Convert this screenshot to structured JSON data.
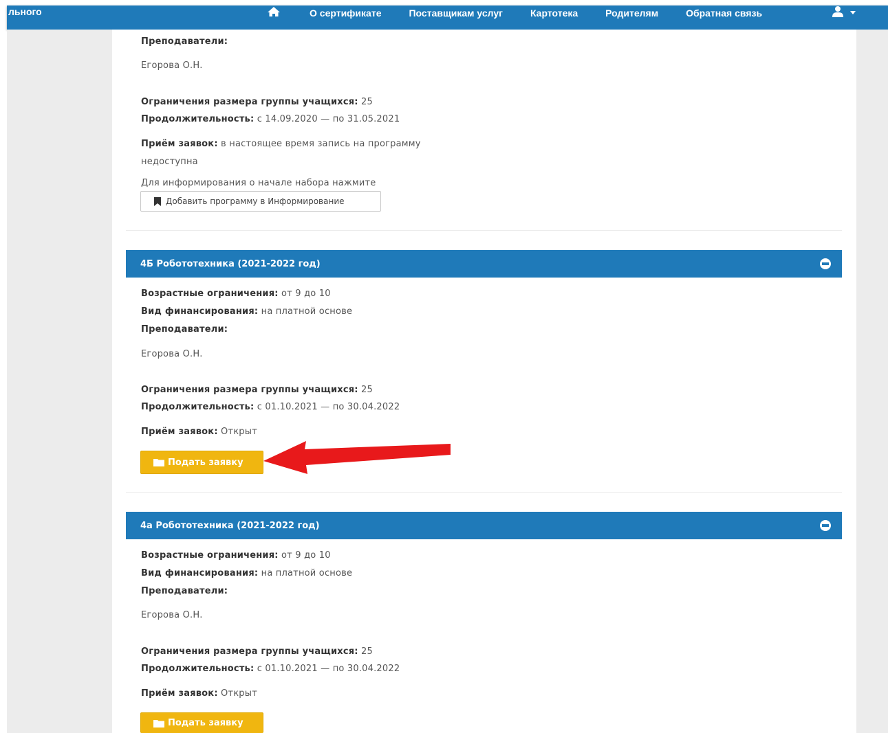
{
  "navbar": {
    "brand_fragment": "льного",
    "home_icon": "home-icon",
    "links": [
      "О сертификате",
      "Поставщикам услуг",
      "Картотека",
      "Родителям",
      "Обратная связь"
    ],
    "user_icon": "user-icon"
  },
  "top_section": {
    "teachers_label": "Преподаватели:",
    "teacher_name": "Егорова О.Н.",
    "group_size_label": "Ограничения размера группы учащихся:",
    "group_size_value": " 25",
    "duration_label": "Продолжительность:",
    "duration_value": " с 14.09.2020 — по 31.05.2021",
    "admission_label": "Приём заявок:",
    "admission_value_1": " в настоящее время запись на программу",
    "admission_value_2": "недоступна",
    "notify_text": "Для информирования о начале набора нажмите",
    "notify_button": "Добавить программу в Информирование"
  },
  "programs": [
    {
      "title": "4Б Робототехника (2021-2022 год)",
      "age_label": "Возрастные ограничения:",
      "age_value": " от 9 до 10",
      "funding_label": "Вид финансирования:",
      "funding_value": " на платной основе",
      "teachers_label": "Преподаватели:",
      "teacher_name": "Егорова О.Н.",
      "group_size_label": "Ограничения размера группы учащихся:",
      "group_size_value": " 25",
      "duration_label": "Продолжительность:",
      "duration_value": " с 01.10.2021 — по 30.04.2022",
      "admission_label": "Приём заявок:",
      "admission_value": " Открыт",
      "apply_button": "Подать заявку"
    },
    {
      "title": "4а Робототехника (2021-2022 год)",
      "age_label": "Возрастные ограничения:",
      "age_value": " от 9 до 10",
      "funding_label": "Вид финансирования:",
      "funding_value": " на платной основе",
      "teachers_label": "Преподаватели:",
      "teacher_name": "Егорова О.Н.",
      "group_size_label": "Ограничения размера группы учащихся:",
      "group_size_value": " 25",
      "duration_label": "Продолжительность:",
      "duration_value": " с 01.10.2021 — по 30.04.2022",
      "admission_label": "Приём заявок:",
      "admission_value": " Открыт",
      "apply_button": "Подать заявку"
    }
  ],
  "colors": {
    "nav_blue": "#1f7ab9",
    "button_yellow": "#f0b610",
    "arrow_red": "#e8191b",
    "page_gray": "#ececec"
  }
}
